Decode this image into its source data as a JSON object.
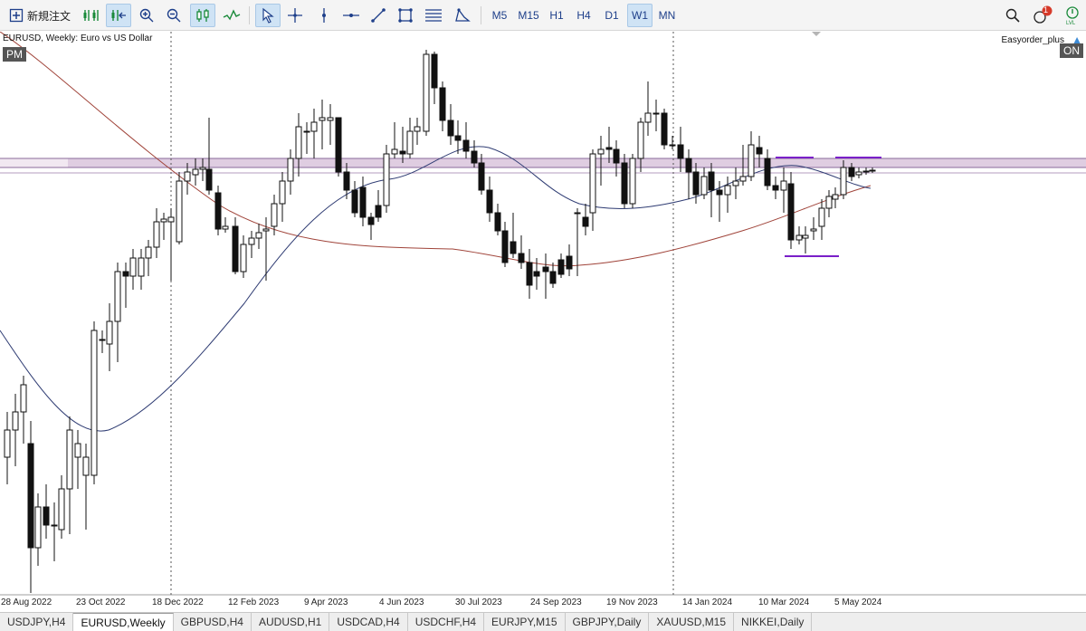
{
  "toolbar": {
    "new_order_label": "新規注文",
    "timeframes": [
      "M5",
      "M15",
      "H1",
      "H4",
      "D1",
      "W1",
      "MN"
    ],
    "active_timeframe": "W1",
    "notification_count": "1",
    "tools": [
      "one-click-trading-icon",
      "autoscroll-icon",
      "chart-shift-icon",
      "zoom-in-icon",
      "zoom-out-icon",
      "candlestick-icon",
      "line-chart-icon",
      "cursor-icon",
      "crosshair-icon",
      "vertical-line-icon",
      "horizontal-line-icon",
      "trendline-icon",
      "rectangle-icon",
      "fibonacci-icon",
      "shapes-icon"
    ]
  },
  "chart": {
    "symbol_label": "EURUSD, Weekly:  Euro vs US Dollar",
    "session_badge": "PM",
    "ea_name": "Easyorder_plus",
    "ea_status": "ON",
    "x_labels": [
      "28 Aug 2022",
      "23 Oct 2022",
      "18 Dec 2022",
      "12 Feb 2023",
      "9 Apr 2023",
      "4 Jun 2023",
      "30 Jul 2023",
      "24 Sep 2023",
      "19 Nov 2023",
      "14 Jan 2024",
      "10 Mar 2024",
      "5 May 2024"
    ]
  },
  "tabs": [
    "USDJPY,H4",
    "EURUSD,Weekly",
    "GBPUSD,H4",
    "AUDUSD,H1",
    "USDCAD,H4",
    "USDCHF,H4",
    "EURJPY,M15",
    "GBPJPY,Daily",
    "XAUUSD,M15",
    "NIKKEI,Daily"
  ],
  "active_tab": "EURUSD,Weekly",
  "colors": {
    "toolbar_bg": "#f4f4f4",
    "active_button": "#cfe3f5",
    "ma_fast": "#2f3c73",
    "ma_slow": "#a0443a",
    "zone": "#d9c4dc",
    "levels": "#7a1fc8",
    "badge": "#555555"
  }
}
